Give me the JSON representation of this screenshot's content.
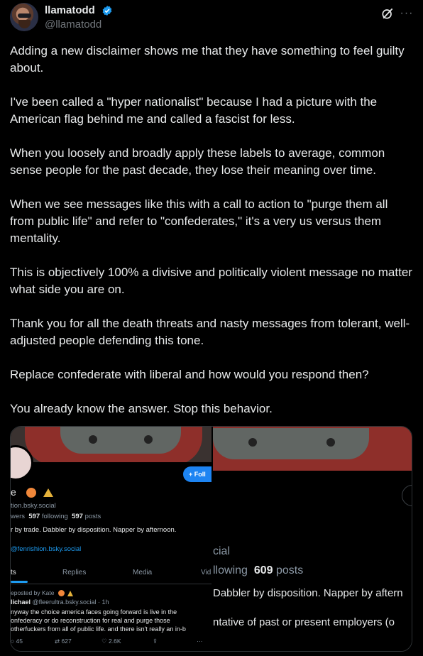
{
  "author": {
    "display_name": "llamatodd",
    "handle": "@llamatodd",
    "verified": true,
    "verified_color": "#1d9bf0"
  },
  "header_icons": [
    "grok-icon",
    "more-icon"
  ],
  "more_glyph": "···",
  "tweet_paragraphs": [
    "Adding a new disclaimer shows me that they have something to feel guilty about.",
    "I've been called a \"hyper nationalist\" because I had a picture with the American flag behind me and called a fascist for less.",
    "When you loosely and broadly apply these labels to average, common sense people for the past decade, they lose their meaning over time.",
    "When we see messages like this with a call to action to \"purge them all from public life\" and refer to \"confederates,\" it's a very us versus them mentality.",
    "This is objectively 100% a divisive and politically violent message no matter what side you are on.",
    "Thank you for all the death threats and nasty messages from tolerant, well-adjusted people defending this tone.",
    "Replace confederate with liberal and how would you respond then?",
    "You already know the answer. Stop this behavior."
  ],
  "media_left": {
    "follow_label": "+ Foll",
    "name_fragment": "e",
    "handle_fragment": "tion.bsky.social",
    "stats": {
      "followers_label": "wers",
      "following_value": "597",
      "following_label": "following",
      "posts_value": "597",
      "posts_label": "posts"
    },
    "bio": "r by trade. Dabbler by disposition. Napper by afternoon.",
    "link": "@fenrishion.bsky.social",
    "tabs": [
      "ts",
      "Replies",
      "Media",
      "Vid"
    ],
    "repost_label": "eposted by Kate",
    "post_author": "lichael",
    "post_handle": "@fleerultra.bsky.social · 1h",
    "post_lines": [
      "nyway the choice america faces going forward is live in the",
      "onfederacy or do reconstruction for real and purge those",
      "otherfuckers from all of public life. and there isn't really an in-b"
    ],
    "actions": {
      "replies": "45",
      "reposts": "627",
      "likes": "2.6K",
      "share": "⇪",
      "more": "···"
    }
  },
  "media_right": {
    "handle_fragment": "cial",
    "following_label": "llowing",
    "posts_value": "609",
    "posts_label": "posts",
    "bio_fragment": "Dabbler by disposition. Napper by aftern",
    "disclaimer_fragment": "ntative of past or present employers (o"
  },
  "colors": {
    "background": "#000000",
    "text": "#e7e9ea",
    "secondary": "#71767b",
    "accent": "#1d9bf0"
  }
}
